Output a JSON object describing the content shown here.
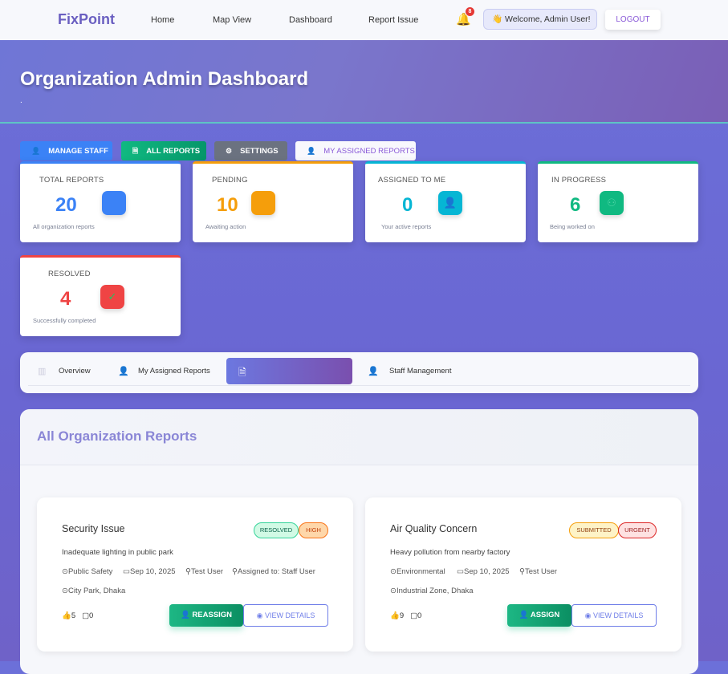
{
  "nav": {
    "logo": "FixPoint",
    "links": [
      "Home",
      "Map View",
      "Dashboard",
      "Report Issue"
    ],
    "notification_count": "8",
    "welcome": "👋 Welcome, Admin User!",
    "logout": "LOGOUT"
  },
  "hero": {
    "title": "Organization Admin Dashboard",
    "subtitle": "."
  },
  "actions": [
    {
      "label": "MANAGE STAFF",
      "color": "#3b82f6"
    },
    {
      "label": "ALL REPORTS",
      "color": "#10b981"
    },
    {
      "label": "SETTINGS",
      "color": "#6b7280"
    },
    {
      "label": "MY ASSIGNED REPORTS",
      "color": "#ffffff"
    }
  ],
  "stats": [
    {
      "label": "TOTAL REPORTS",
      "value": "20",
      "sub": "All organization reports",
      "color": "#3b82f6"
    },
    {
      "label": "PENDING",
      "value": "10",
      "sub": "Awaiting action",
      "color": "#f59e0b"
    },
    {
      "label": "ASSIGNED TO ME",
      "value": "0",
      "sub": "Your active reports",
      "color": "#06b6d4"
    },
    {
      "label": "IN PROGRESS",
      "value": "6",
      "sub": "Being worked on",
      "color": "#10b981"
    },
    {
      "label": "RESOLVED",
      "value": "4",
      "sub": "Successfully completed",
      "color": "#ef4444"
    }
  ],
  "tabs": {
    "items": [
      "Overview",
      "My Assigned Reports",
      "",
      "Staff Management"
    ],
    "active_index": 2
  },
  "reports": {
    "title": "All Organization Reports",
    "items": [
      {
        "title": "Security Issue",
        "status": "RESOLVED",
        "priority": "HIGH",
        "description": "Inadequate lighting in public park",
        "category": "Public Safety",
        "date": "Sep 10, 2025",
        "reporter": "Test User",
        "assigned": "Assigned to: Staff User",
        "location": "City Park, Dhaka",
        "likes": "5",
        "comments": "0",
        "action": "REASSIGN",
        "view": "VIEW DETAILS"
      },
      {
        "title": "Air Quality Concern",
        "status": "SUBMITTED",
        "priority": "URGENT",
        "description": "Heavy pollution from nearby factory",
        "category": "Environmental",
        "date": "Sep 10, 2025",
        "reporter": "Test User",
        "location": "Industrial Zone, Dhaka",
        "likes": "9",
        "comments": "0",
        "action": "ASSIGN",
        "view": "VIEW DETAILS"
      }
    ]
  }
}
